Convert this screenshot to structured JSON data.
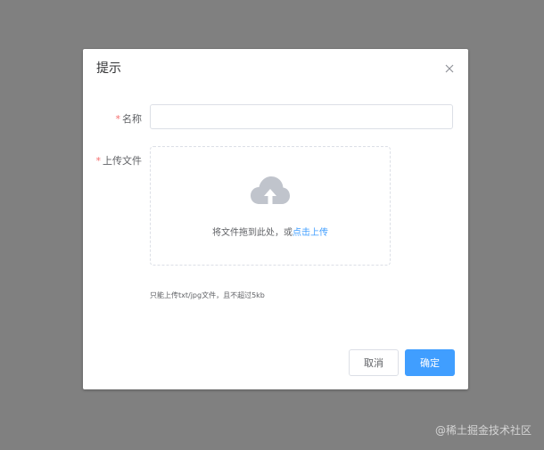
{
  "dialog": {
    "title": "提示",
    "close_icon": "close-icon"
  },
  "form": {
    "required_mark": "*",
    "name_label": "名称",
    "name_value": "",
    "upload_label": "上传文件",
    "upload_icon": "cloud-upload-icon",
    "upload_text": "将文件拖到此处，或",
    "upload_link": "点击上传",
    "tip": "只能上传txt/jpg文件，且不超过5kb"
  },
  "footer": {
    "cancel_label": "取消",
    "confirm_label": "确定"
  },
  "watermark": "@稀土掘金技术社区",
  "colors": {
    "overlay": "#808080",
    "primary": "#409eff",
    "required": "#f56c6c",
    "border": "#dcdfe6",
    "icon": "#c0c4cc"
  }
}
